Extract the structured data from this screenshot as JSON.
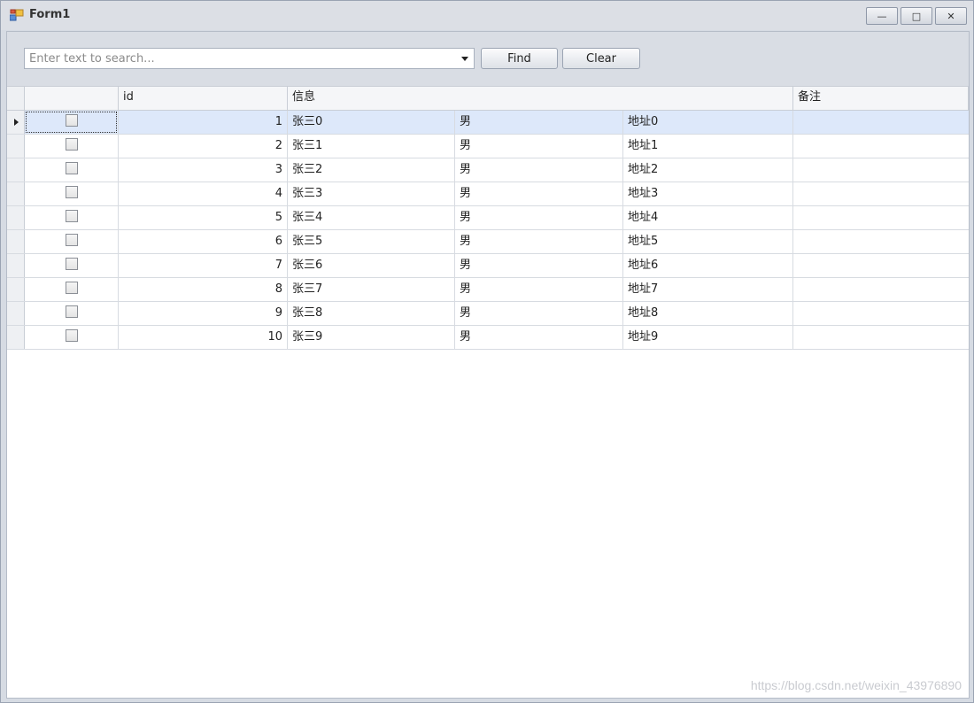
{
  "window": {
    "title": "Form1",
    "minimize_glyph": "—",
    "maximize_glyph": "□",
    "close_glyph": "✕"
  },
  "toolbar": {
    "search_placeholder": "Enter text to search...",
    "find_label": "Find",
    "clear_label": "Clear"
  },
  "grid": {
    "headers": {
      "check": "",
      "id": "id",
      "info": "信息",
      "note": "备注"
    },
    "rows": [
      {
        "id": "1",
        "name": "张三0",
        "sex": "男",
        "address": "地址0",
        "note": "",
        "checked": false
      },
      {
        "id": "2",
        "name": "张三1",
        "sex": "男",
        "address": "地址1",
        "note": "",
        "checked": false
      },
      {
        "id": "3",
        "name": "张三2",
        "sex": "男",
        "address": "地址2",
        "note": "",
        "checked": false
      },
      {
        "id": "4",
        "name": "张三3",
        "sex": "男",
        "address": "地址3",
        "note": "",
        "checked": false
      },
      {
        "id": "5",
        "name": "张三4",
        "sex": "男",
        "address": "地址4",
        "note": "",
        "checked": false
      },
      {
        "id": "6",
        "name": "张三5",
        "sex": "男",
        "address": "地址5",
        "note": "",
        "checked": false
      },
      {
        "id": "7",
        "name": "张三6",
        "sex": "男",
        "address": "地址6",
        "note": "",
        "checked": false
      },
      {
        "id": "8",
        "name": "张三7",
        "sex": "男",
        "address": "地址7",
        "note": "",
        "checked": false
      },
      {
        "id": "9",
        "name": "张三8",
        "sex": "男",
        "address": "地址8",
        "note": "",
        "checked": false
      },
      {
        "id": "10",
        "name": "张三9",
        "sex": "男",
        "address": "地址9",
        "note": "",
        "checked": false
      }
    ],
    "selected_row": 0
  },
  "watermark": "https://blog.csdn.net/weixin_43976890",
  "colors": {
    "selected_row": "#dde8fa",
    "titlebar": "#dcdfe5",
    "toolbar": "#d9dde4"
  }
}
